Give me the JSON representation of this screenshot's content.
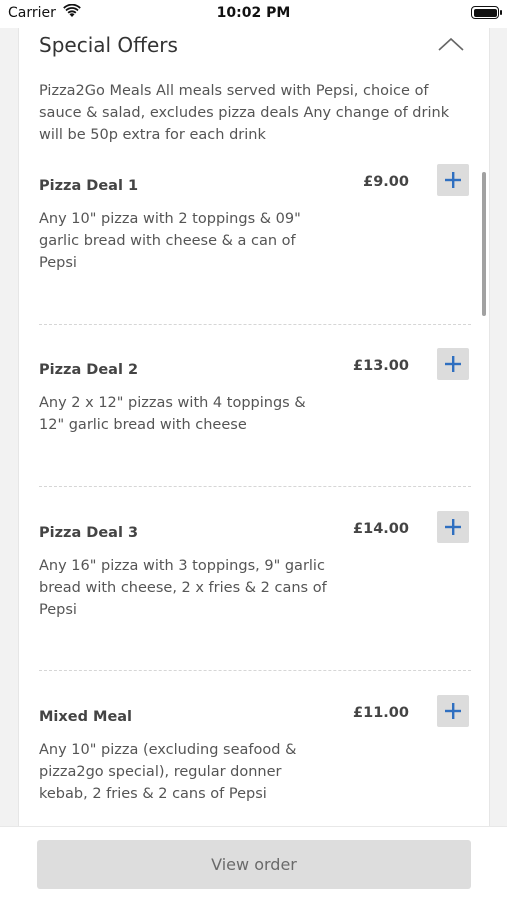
{
  "status_bar": {
    "carrier": "Carrier",
    "time": "10:02 PM"
  },
  "section": {
    "title": "Special Offers",
    "intro": "Pizza2Go Meals All meals served with Pepsi, choice of sauce & salad, excludes pizza deals Any change of drink will be 50p extra for each drink"
  },
  "items": [
    {
      "name": "Pizza Deal 1",
      "price": "£9.00",
      "description": "Any 10\" pizza with 2 toppings & 09\" garlic bread with cheese & a can of Pepsi"
    },
    {
      "name": "Pizza Deal 2",
      "price": "£13.00",
      "description": "Any 2 x 12\" pizzas with 4 toppings & 12\" garlic bread with cheese"
    },
    {
      "name": "Pizza Deal 3",
      "price": "£14.00",
      "description": "Any 16\" pizza with 3 toppings, 9\" garlic bread with cheese, 2 x fries & 2 cans of Pepsi"
    },
    {
      "name": "Mixed Meal",
      "price": "£11.00",
      "description": "Any 10\" pizza (excluding seafood & pizza2go special), regular donner kebab, 2 fries & 2 cans of Pepsi"
    }
  ],
  "bottom_bar": {
    "view_order_label": "View order"
  },
  "colors": {
    "accent": "#2f6fc0",
    "button_bg": "#dcdcdc",
    "background": "#f2f2f2"
  },
  "icons": {
    "collapse": "chevron-up-icon",
    "add": "plus-icon",
    "wifi": "wifi-icon",
    "battery": "battery-icon"
  }
}
